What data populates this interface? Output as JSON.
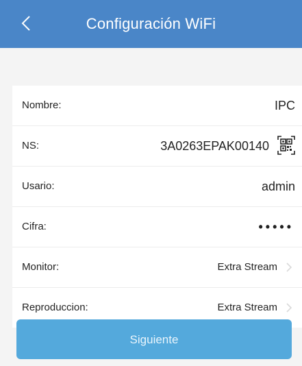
{
  "header": {
    "title": "Configuración WiFi"
  },
  "form": {
    "name_label": "Nombre:",
    "name_value": "IPC",
    "ns_label": "NS:",
    "ns_value": "3A0263EPAK00140",
    "user_label": "Usario:",
    "user_value": "admin",
    "password_label": "Cifra:",
    "password_value": "•••••",
    "monitor_label": "Monitor:",
    "monitor_value": "Extra Stream",
    "playback_label": "Reproduccion:",
    "playback_value": "Extra Stream"
  },
  "actions": {
    "next_label": "Siguiente"
  },
  "colors": {
    "header": "#4a86c8",
    "button": "#54a9dc",
    "background": "#f4f4f4"
  },
  "icons": {
    "back": "chevron-left-icon",
    "qr": "qr-code-icon",
    "chevron": "chevron-right-icon"
  }
}
